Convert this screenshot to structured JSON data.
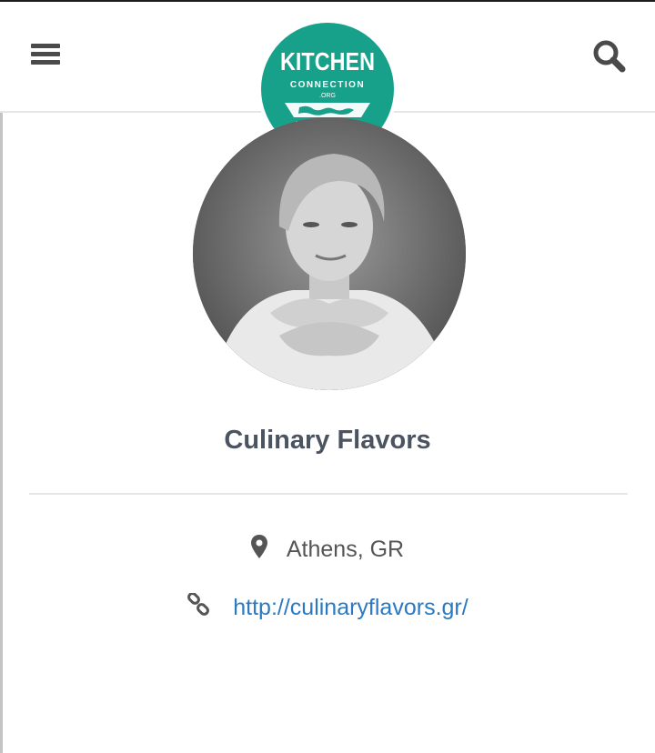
{
  "header": {
    "logo": {
      "brand_line1": "KITCHEN",
      "brand_line2": "CONNECTION",
      "brand_line3": ".ORG",
      "color": "#17a08a"
    },
    "menu_icon": "hamburger-icon",
    "search_icon": "search-icon"
  },
  "profile": {
    "name": "Culinary Flavors",
    "location": "Athens, GR",
    "website": "http://culinaryflavors.gr/",
    "location_icon": "map-pin-icon",
    "website_icon": "link-icon"
  },
  "colors": {
    "name_text": "#4b5460",
    "link": "#2a79c2",
    "accent": "#17a08a"
  }
}
